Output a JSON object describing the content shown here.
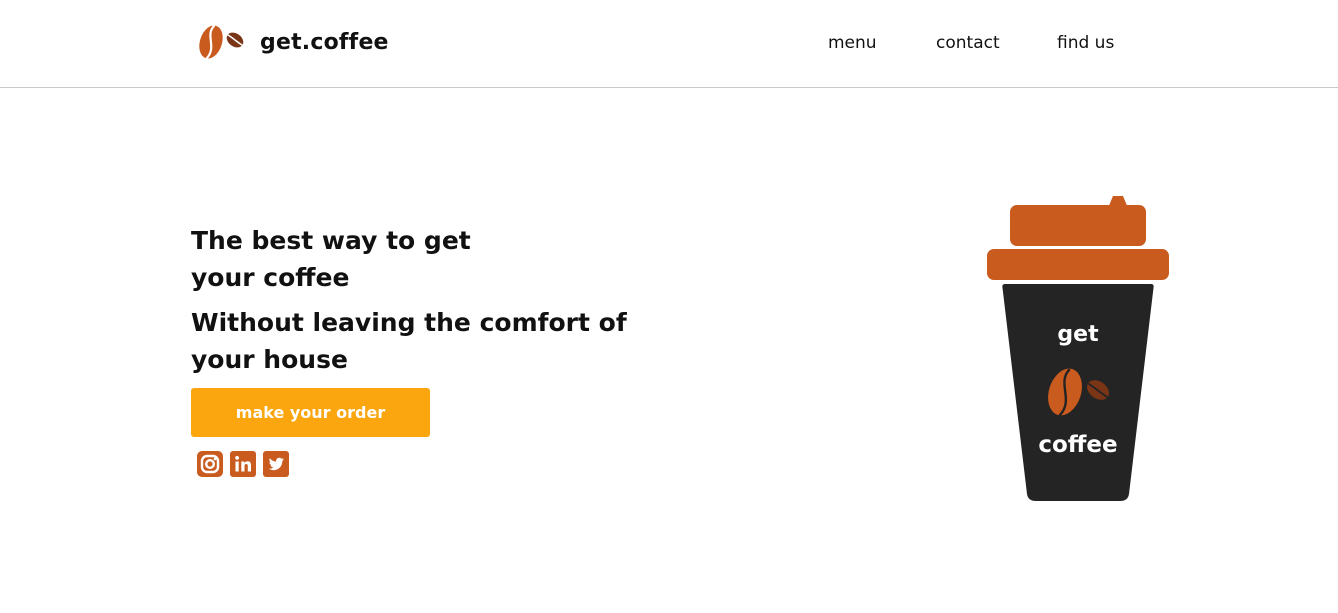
{
  "brand": {
    "name": "get.coffee",
    "logo_icon": "coffee-beans-icon",
    "primary_color": "#c95b1e",
    "accent_color": "#fba50f",
    "dark_color": "#242424"
  },
  "nav": {
    "items": [
      {
        "label": "menu"
      },
      {
        "label": "contact"
      },
      {
        "label": "find us"
      }
    ]
  },
  "hero": {
    "headline_1": "The best way to get your coffee",
    "headline_2": "Without leaving the comfort of your house",
    "cta_label": "make your order"
  },
  "socials": [
    {
      "icon": "instagram-icon"
    },
    {
      "icon": "linkedin-icon"
    },
    {
      "icon": "twitter-icon"
    }
  ],
  "cup": {
    "top_text": "get",
    "bottom_text": "coffee"
  }
}
